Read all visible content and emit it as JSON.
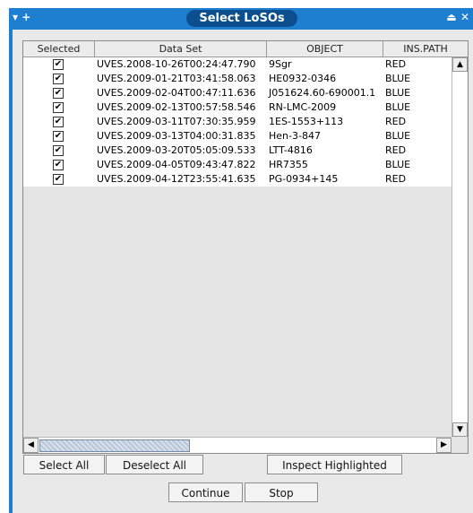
{
  "window": {
    "title": "Select LoSOs",
    "left_icons": "▾ +",
    "right_icons": "⏏ ✕"
  },
  "table": {
    "columns": [
      "Selected",
      "Data Set",
      "OBJECT",
      "INS.PATH"
    ],
    "rows": [
      {
        "selected": true,
        "dataset": "UVES.2008-10-26T00:24:47.790",
        "object": "9Sgr",
        "ins_path": "RED"
      },
      {
        "selected": true,
        "dataset": "UVES.2009-01-21T03:41:58.063",
        "object": "HE0932-0346",
        "ins_path": "BLUE"
      },
      {
        "selected": true,
        "dataset": "UVES.2009-02-04T00:47:11.636",
        "object": "J051624.60-690001.1",
        "ins_path": "BLUE"
      },
      {
        "selected": true,
        "dataset": "UVES.2009-02-13T00:57:58.546",
        "object": "RN-LMC-2009",
        "ins_path": "BLUE"
      },
      {
        "selected": true,
        "dataset": "UVES.2009-03-11T07:30:35.959",
        "object": "1ES-1553+113",
        "ins_path": "RED"
      },
      {
        "selected": true,
        "dataset": "UVES.2009-03-13T04:00:31.835",
        "object": "Hen-3-847",
        "ins_path": "BLUE"
      },
      {
        "selected": true,
        "dataset": "UVES.2009-03-20T05:05:09.533",
        "object": "LTT-4816",
        "ins_path": "RED"
      },
      {
        "selected": true,
        "dataset": "UVES.2009-04-05T09:43:47.822",
        "object": "HR7355",
        "ins_path": "BLUE"
      },
      {
        "selected": true,
        "dataset": "UVES.2009-04-12T23:55:41.635",
        "object": "PG-0934+145",
        "ins_path": "RED"
      }
    ]
  },
  "buttons": {
    "select_all": "Select All",
    "deselect_all": "Deselect All",
    "inspect_highlighted": "Inspect Highlighted",
    "continue": "Continue",
    "stop": "Stop"
  },
  "icons": {
    "checkbox_checked": "check-icon",
    "scroll_up": "arrow-up-icon",
    "scroll_down": "arrow-down-icon",
    "scroll_left": "arrow-left-icon",
    "scroll_right": "arrow-right-icon"
  }
}
